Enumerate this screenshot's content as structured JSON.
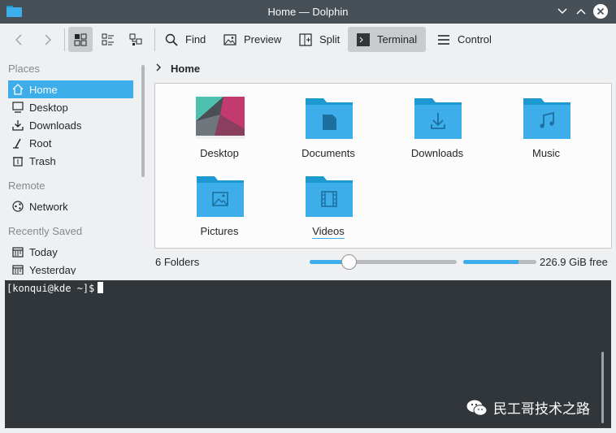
{
  "window": {
    "title": "Home — Dolphin"
  },
  "toolbar": {
    "find_label": "Find",
    "preview_label": "Preview",
    "split_label": "Split",
    "terminal_label": "Terminal",
    "control_label": "Control"
  },
  "places": {
    "header": "Places",
    "items": [
      {
        "label": "Home",
        "icon": "home-icon",
        "selected": true
      },
      {
        "label": "Desktop",
        "icon": "desktop-icon"
      },
      {
        "label": "Downloads",
        "icon": "download-icon"
      },
      {
        "label": "Root",
        "icon": "root-icon"
      },
      {
        "label": "Trash",
        "icon": "trash-icon"
      }
    ],
    "remote_header": "Remote",
    "remote_items": [
      {
        "label": "Network",
        "icon": "network-icon"
      }
    ],
    "recent_header": "Recently Saved",
    "recent_items": [
      {
        "label": "Today",
        "icon": "calendar-icon"
      },
      {
        "label": "Yesterday",
        "icon": "calendar-icon"
      }
    ]
  },
  "breadcrumb": {
    "current": "Home"
  },
  "files": [
    {
      "name": "Desktop",
      "icon": "desktop-wallpaper-icon"
    },
    {
      "name": "Documents",
      "icon": "folder-documents-icon"
    },
    {
      "name": "Downloads",
      "icon": "folder-downloads-icon"
    },
    {
      "name": "Music",
      "icon": "folder-music-icon"
    },
    {
      "name": "Pictures",
      "icon": "folder-pictures-icon"
    },
    {
      "name": "Videos",
      "icon": "folder-videos-icon"
    }
  ],
  "status": {
    "summary": "6 Folders",
    "zoom_level": 0.27,
    "disk_used_fraction": 0.75,
    "free_space": "226.9 GiB free"
  },
  "terminal": {
    "prompt": "[konqui@kde ~]$"
  },
  "watermark": {
    "text": "民工哥技术之路"
  },
  "colors": {
    "accent": "#3daee9",
    "titlebar": "#475057",
    "terminal_bg": "#31363b",
    "folder_blue": "#3daee9",
    "folder_tab": "#1d99d2"
  }
}
